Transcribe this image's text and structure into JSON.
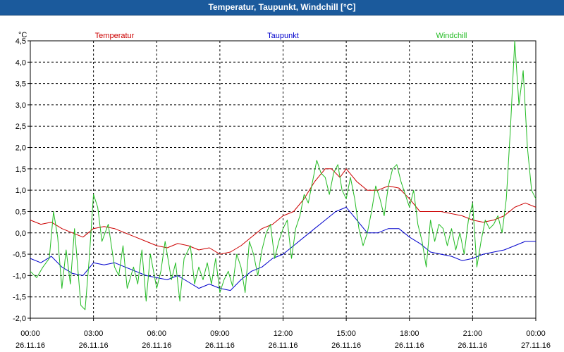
{
  "window": {
    "title": "Temperatur, Taupunkt, Windchill [°C]"
  },
  "chart_data": {
    "type": "line",
    "ylabel": "°C",
    "ylim": [
      -2.0,
      4.5
    ],
    "yticks": [
      "4,5",
      "4,0",
      "3,5",
      "3,0",
      "2,5",
      "2,0",
      "1,5",
      "1,0",
      "0,5",
      "0,0",
      "-0,5",
      "-1,0",
      "-1,5",
      "-2,0"
    ],
    "xlim": [
      0,
      24
    ],
    "xticks": [
      {
        "time": "00:00",
        "date": "26.11.16"
      },
      {
        "time": "03:00",
        "date": "26.11.16"
      },
      {
        "time": "06:00",
        "date": "26.11.16"
      },
      {
        "time": "09:00",
        "date": "26.11.16"
      },
      {
        "time": "12:00",
        "date": "26.11.16"
      },
      {
        "time": "15:00",
        "date": "26.11.16"
      },
      {
        "time": "18:00",
        "date": "26.11.16"
      },
      {
        "time": "21:00",
        "date": "26.11.16"
      },
      {
        "time": "00:00",
        "date": "27.11.16"
      }
    ],
    "grid": true,
    "legend_position": "top",
    "series": [
      {
        "name": "Temperatur",
        "color": "#cc0000",
        "points": [
          [
            0,
            0.3
          ],
          [
            0.5,
            0.2
          ],
          [
            1,
            0.25
          ],
          [
            1.5,
            0.1
          ],
          [
            2,
            0.0
          ],
          [
            2.5,
            -0.1
          ],
          [
            3,
            0.1
          ],
          [
            3.5,
            0.15
          ],
          [
            4,
            0.1
          ],
          [
            4.5,
            0.0
          ],
          [
            5,
            -0.1
          ],
          [
            5.5,
            -0.2
          ],
          [
            6,
            -0.3
          ],
          [
            6.5,
            -0.35
          ],
          [
            7,
            -0.25
          ],
          [
            7.5,
            -0.3
          ],
          [
            8,
            -0.4
          ],
          [
            8.5,
            -0.35
          ],
          [
            9,
            -0.5
          ],
          [
            9.5,
            -0.45
          ],
          [
            10,
            -0.3
          ],
          [
            10.5,
            -0.1
          ],
          [
            11,
            0.1
          ],
          [
            11.5,
            0.2
          ],
          [
            12,
            0.4
          ],
          [
            12.5,
            0.5
          ],
          [
            13,
            0.8
          ],
          [
            13.5,
            1.2
          ],
          [
            14,
            1.5
          ],
          [
            14.3,
            1.5
          ],
          [
            14.7,
            1.3
          ],
          [
            15,
            1.5
          ],
          [
            15.5,
            1.2
          ],
          [
            16,
            1.0
          ],
          [
            16.5,
            1.0
          ],
          [
            17,
            1.1
          ],
          [
            17.5,
            1.05
          ],
          [
            18,
            0.8
          ],
          [
            18.5,
            0.5
          ],
          [
            19,
            0.5
          ],
          [
            19.5,
            0.5
          ],
          [
            20,
            0.45
          ],
          [
            20.5,
            0.4
          ],
          [
            21,
            0.3
          ],
          [
            21.5,
            0.25
          ],
          [
            22,
            0.3
          ],
          [
            22.5,
            0.4
          ],
          [
            23,
            0.6
          ],
          [
            23.5,
            0.7
          ],
          [
            24,
            0.6
          ]
        ]
      },
      {
        "name": "Taupunkt",
        "color": "#0000cc",
        "points": [
          [
            0,
            -0.6
          ],
          [
            0.5,
            -0.7
          ],
          [
            1,
            -0.55
          ],
          [
            1.5,
            -0.8
          ],
          [
            2,
            -0.95
          ],
          [
            2.5,
            -1.0
          ],
          [
            3,
            -0.7
          ],
          [
            3.5,
            -0.75
          ],
          [
            4,
            -0.7
          ],
          [
            4.5,
            -0.8
          ],
          [
            5,
            -0.9
          ],
          [
            5.5,
            -1.0
          ],
          [
            6,
            -1.05
          ],
          [
            6.5,
            -1.1
          ],
          [
            7,
            -1.0
          ],
          [
            7.5,
            -1.15
          ],
          [
            8,
            -1.3
          ],
          [
            8.5,
            -1.2
          ],
          [
            9,
            -1.3
          ],
          [
            9.5,
            -1.35
          ],
          [
            10,
            -1.1
          ],
          [
            10.5,
            -0.9
          ],
          [
            11,
            -0.8
          ],
          [
            11.5,
            -0.6
          ],
          [
            12,
            -0.5
          ],
          [
            12.5,
            -0.3
          ],
          [
            13,
            -0.1
          ],
          [
            13.5,
            0.1
          ],
          [
            14,
            0.3
          ],
          [
            14.5,
            0.5
          ],
          [
            15,
            0.6
          ],
          [
            15.5,
            0.3
          ],
          [
            16,
            0.0
          ],
          [
            16.5,
            0.0
          ],
          [
            17,
            0.1
          ],
          [
            17.5,
            0.1
          ],
          [
            18,
            -0.1
          ],
          [
            18.5,
            -0.25
          ],
          [
            19,
            -0.45
          ],
          [
            19.5,
            -0.5
          ],
          [
            20,
            -0.55
          ],
          [
            20.5,
            -0.65
          ],
          [
            21,
            -0.6
          ],
          [
            21.5,
            -0.5
          ],
          [
            22,
            -0.45
          ],
          [
            22.5,
            -0.4
          ],
          [
            23,
            -0.3
          ],
          [
            23.5,
            -0.2
          ],
          [
            24,
            -0.2
          ]
        ]
      },
      {
        "name": "Windchill",
        "color": "#22bb22",
        "points": [
          [
            0,
            -0.9
          ],
          [
            0.3,
            -1.05
          ],
          [
            0.6,
            -0.8
          ],
          [
            0.9,
            -0.6
          ],
          [
            1.1,
            0.5
          ],
          [
            1.3,
            -0.1
          ],
          [
            1.5,
            -1.3
          ],
          [
            1.7,
            -0.4
          ],
          [
            1.9,
            -1.2
          ],
          [
            2.1,
            0.1
          ],
          [
            2.4,
            -1.7
          ],
          [
            2.6,
            -1.8
          ],
          [
            2.8,
            -0.6
          ],
          [
            3.0,
            0.9
          ],
          [
            3.2,
            0.6
          ],
          [
            3.4,
            -0.2
          ],
          [
            3.7,
            0.2
          ],
          [
            4.0,
            -0.8
          ],
          [
            4.2,
            -1.0
          ],
          [
            4.4,
            -0.3
          ],
          [
            4.6,
            -1.3
          ],
          [
            4.9,
            -0.8
          ],
          [
            5.1,
            -1.2
          ],
          [
            5.3,
            -0.4
          ],
          [
            5.5,
            -1.6
          ],
          [
            5.7,
            -0.5
          ],
          [
            6.0,
            -1.3
          ],
          [
            6.2,
            -0.9
          ],
          [
            6.4,
            -0.2
          ],
          [
            6.7,
            -1.1
          ],
          [
            6.9,
            -0.7
          ],
          [
            7.1,
            -1.6
          ],
          [
            7.3,
            -0.6
          ],
          [
            7.6,
            -0.3
          ],
          [
            7.8,
            -1.2
          ],
          [
            8.0,
            -0.8
          ],
          [
            8.2,
            -1.1
          ],
          [
            8.4,
            -0.7
          ],
          [
            8.6,
            -1.2
          ],
          [
            8.8,
            -0.6
          ],
          [
            9.0,
            -1.4
          ],
          [
            9.2,
            -1.1
          ],
          [
            9.4,
            -0.9
          ],
          [
            9.6,
            -1.25
          ],
          [
            9.8,
            -0.5
          ],
          [
            10.0,
            -0.8
          ],
          [
            10.2,
            -1.4
          ],
          [
            10.4,
            -0.2
          ],
          [
            10.6,
            -0.5
          ],
          [
            10.8,
            -1.0
          ],
          [
            11.0,
            -0.4
          ],
          [
            11.2,
            0.0
          ],
          [
            11.4,
            0.2
          ],
          [
            11.6,
            -0.6
          ],
          [
            11.8,
            -0.2
          ],
          [
            12.0,
            0.1
          ],
          [
            12.2,
            0.3
          ],
          [
            12.4,
            -0.6
          ],
          [
            12.6,
            0.1
          ],
          [
            12.8,
            0.4
          ],
          [
            13.0,
            0.9
          ],
          [
            13.2,
            0.7
          ],
          [
            13.4,
            1.2
          ],
          [
            13.6,
            1.7
          ],
          [
            13.8,
            1.4
          ],
          [
            14.0,
            1.3
          ],
          [
            14.2,
            0.9
          ],
          [
            14.4,
            1.4
          ],
          [
            14.6,
            1.6
          ],
          [
            14.8,
            1.0
          ],
          [
            15.0,
            0.8
          ],
          [
            15.2,
            1.3
          ],
          [
            15.4,
            0.8
          ],
          [
            15.6,
            0.1
          ],
          [
            15.8,
            -0.3
          ],
          [
            16.0,
            0.0
          ],
          [
            16.2,
            0.5
          ],
          [
            16.4,
            1.1
          ],
          [
            16.6,
            0.8
          ],
          [
            16.8,
            0.4
          ],
          [
            17.0,
            1.1
          ],
          [
            17.2,
            1.5
          ],
          [
            17.4,
            1.6
          ],
          [
            17.6,
            1.2
          ],
          [
            17.8,
            0.9
          ],
          [
            18.0,
            0.6
          ],
          [
            18.2,
            1.0
          ],
          [
            18.4,
            0.2
          ],
          [
            18.6,
            -0.2
          ],
          [
            18.8,
            -0.8
          ],
          [
            19.0,
            0.3
          ],
          [
            19.2,
            -0.2
          ],
          [
            19.4,
            0.2
          ],
          [
            19.6,
            0.1
          ],
          [
            19.8,
            -0.3
          ],
          [
            20.0,
            0.1
          ],
          [
            20.2,
            -0.4
          ],
          [
            20.4,
            0.0
          ],
          [
            20.6,
            -0.5
          ],
          [
            20.8,
            0.3
          ],
          [
            21.0,
            0.7
          ],
          [
            21.2,
            -0.8
          ],
          [
            21.4,
            -0.2
          ],
          [
            21.6,
            0.3
          ],
          [
            21.8,
            0.1
          ],
          [
            22.0,
            0.2
          ],
          [
            22.2,
            0.4
          ],
          [
            22.4,
            0.0
          ],
          [
            22.6,
            0.8
          ],
          [
            22.8,
            2.5
          ],
          [
            23.0,
            4.5
          ],
          [
            23.2,
            3.0
          ],
          [
            23.4,
            3.8
          ],
          [
            23.6,
            2.0
          ],
          [
            23.8,
            1.0
          ],
          [
            24.0,
            0.8
          ]
        ]
      }
    ]
  }
}
